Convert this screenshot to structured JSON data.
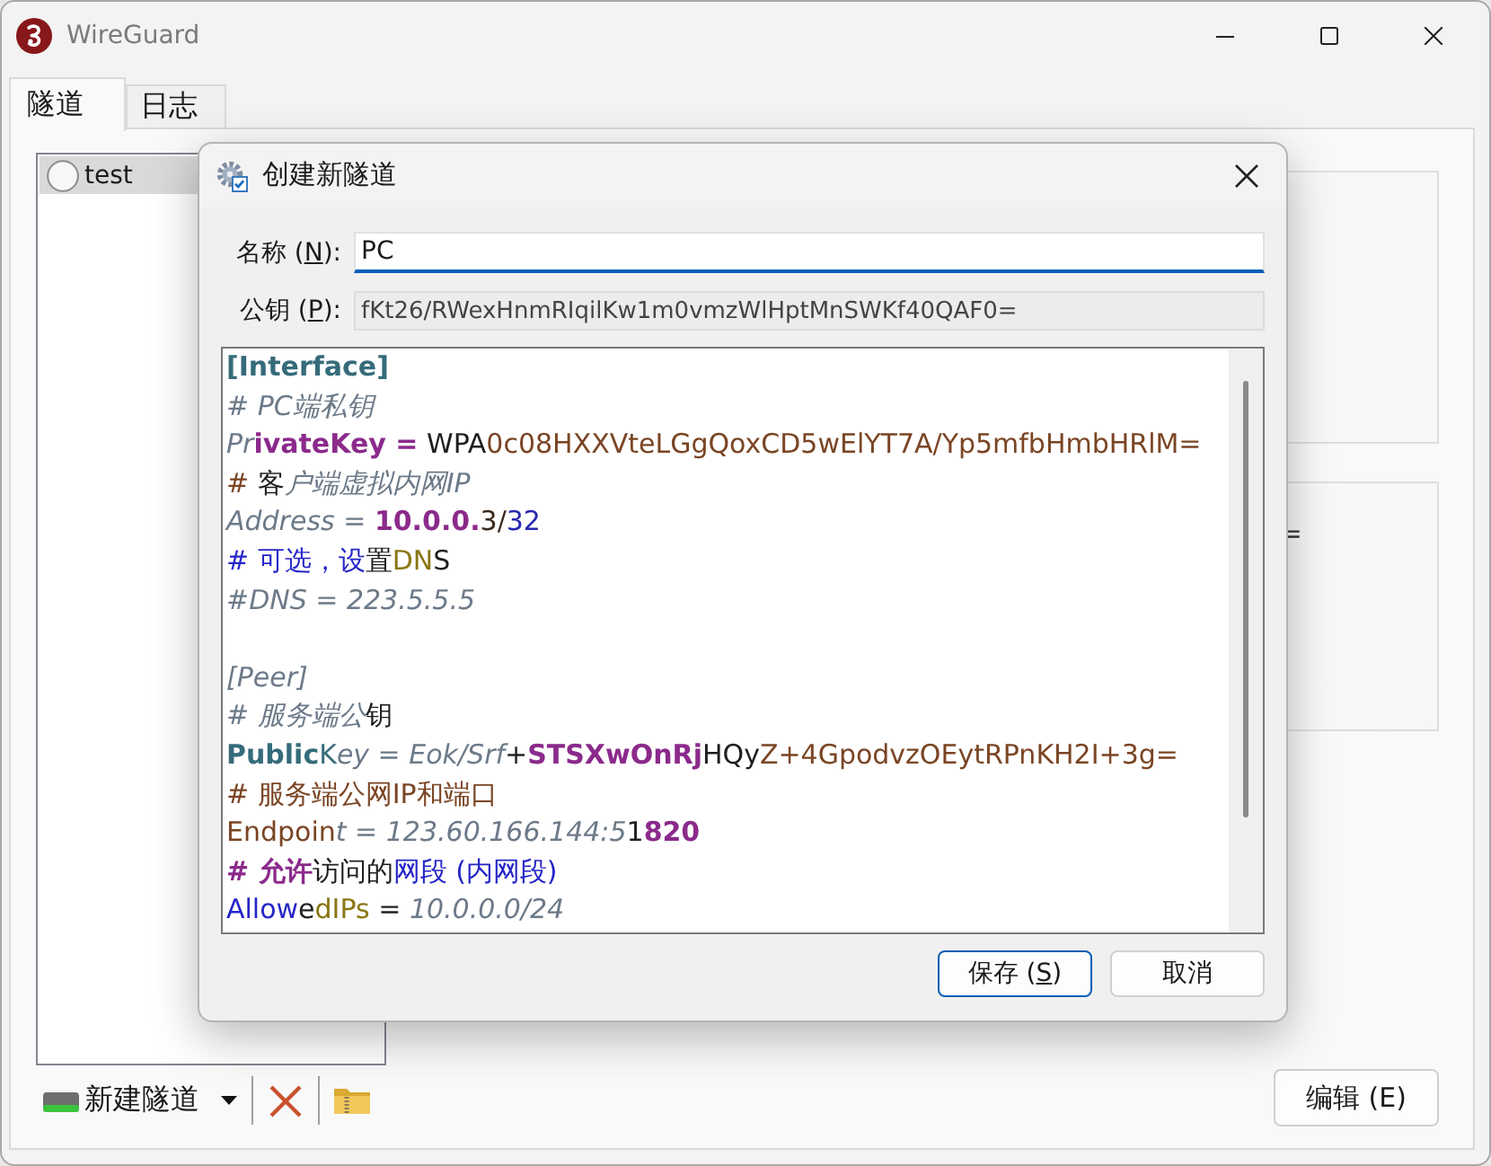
{
  "window": {
    "title": "WireGuard"
  },
  "tabs": [
    {
      "label": "隧道",
      "selected": true
    },
    {
      "label": "日志",
      "selected": false
    }
  ],
  "tunnels": [
    {
      "name": "test",
      "selected": true
    }
  ],
  "details": {
    "visible_text": "="
  },
  "toolbar": {
    "new_tunnel": "新建隧道"
  },
  "edit_button": "编辑 (E)",
  "dialog": {
    "title": "创建新隧道",
    "fields": [
      {
        "kind": "input",
        "label": "名称 (",
        "access_key": "N",
        "label_after": "):",
        "value": "PC",
        "focused": true
      },
      {
        "kind": "readonly",
        "label": "公钥 (",
        "access_key": "P",
        "label_after": "):",
        "value": "fKt26/RWexHnmRIqilKw1m0vmzWlHptMnSWKf40QAF0=",
        "focused": false
      }
    ],
    "editor": {
      "lines": [
        {
          "kind": "code",
          "segments": [
            {
              "text": "[Interface]",
              "color": "#356b7a",
              "bold": true,
              "italic": false
            }
          ]
        },
        {
          "kind": "code",
          "segments": [
            {
              "text": "# PC端私钥",
              "color": "#6c7a89",
              "bold": false,
              "italic": true
            }
          ]
        },
        {
          "kind": "code",
          "segments": [
            {
              "text": "Pr",
              "color": "#6c7a89",
              "bold": false,
              "italic": true
            },
            {
              "text": "ivateKey =",
              "color": "#8b2a8b",
              "bold": true,
              "italic": false
            },
            {
              "text": " WPA",
              "color": "#1e1e1e",
              "bold": false,
              "italic": false
            },
            {
              "text": "0c08HXXVteLGgQoxCD5wElYT7A/Yp5mfbHmbHRlM=",
              "color": "#7a4524",
              "bold": false,
              "italic": false
            }
          ]
        },
        {
          "kind": "code",
          "segments": [
            {
              "text": "# ",
              "color": "#7a4524",
              "bold": false,
              "italic": false
            },
            {
              "text": "客",
              "color": "#1e1e1e",
              "bold": false,
              "italic": false
            },
            {
              "text": "户端虚拟内网IP",
              "color": "#6c7a89",
              "bold": false,
              "italic": true
            }
          ]
        },
        {
          "kind": "code",
          "segments": [
            {
              "text": "Address = ",
              "color": "#6c7a89",
              "bold": false,
              "italic": true
            },
            {
              "text": "10.0.0.",
              "color": "#8b2a8b",
              "bold": true,
              "italic": false
            },
            {
              "text": "3/",
              "color": "#3b2a1e",
              "bold": false,
              "italic": false
            },
            {
              "text": "32",
              "color": "#2727b0",
              "bold": false,
              "italic": false
            }
          ]
        },
        {
          "kind": "code",
          "segments": [
            {
              "text": "# 可选，设",
              "color": "#2525c8",
              "bold": false,
              "italic": false
            },
            {
              "text": "置",
              "color": "#1e1e1e",
              "bold": false,
              "italic": false
            },
            {
              "text": "DN",
              "color": "#8a7714",
              "bold": false,
              "italic": false
            },
            {
              "text": "S",
              "color": "#1e1e1e",
              "bold": false,
              "italic": false
            }
          ]
        },
        {
          "kind": "code",
          "segments": [
            {
              "text": "#DNS = 223.5.5.5",
              "color": "#6c7a89",
              "bold": false,
              "italic": true
            }
          ]
        },
        {
          "kind": "blank"
        },
        {
          "kind": "code",
          "segments": [
            {
              "text": "[Peer]",
              "color": "#6c7a89",
              "bold": false,
              "italic": true
            }
          ]
        },
        {
          "kind": "code",
          "segments": [
            {
              "text": "# 服务端公",
              "color": "#6c7a89",
              "bold": false,
              "italic": true
            },
            {
              "text": "钥",
              "color": "#1e1e1e",
              "bold": false,
              "italic": false
            }
          ]
        },
        {
          "kind": "code",
          "segments": [
            {
              "text": "Public",
              "color": "#356b7a",
              "bold": true,
              "italic": false
            },
            {
              "text": "K",
              "color": "#356b7a",
              "bold": false,
              "italic": false
            },
            {
              "text": "ey = Eok/Srf",
              "color": "#6c7a89",
              "bold": false,
              "italic": true
            },
            {
              "text": "+",
              "color": "#1e1e1e",
              "bold": false,
              "italic": false
            },
            {
              "text": "STSXwOnRj",
              "color": "#8b2a8b",
              "bold": true,
              "italic": false
            },
            {
              "text": "HQy",
              "color": "#1e1e1e",
              "bold": false,
              "italic": false
            },
            {
              "text": "Z+4GpodvzOEytRPnKH2I+3g=",
              "color": "#7a4524",
              "bold": false,
              "italic": false
            }
          ]
        },
        {
          "kind": "code",
          "segments": [
            {
              "text": "# 服务端公网IP和端口",
              "color": "#7a4524",
              "bold": false,
              "italic": false
            }
          ]
        },
        {
          "kind": "code",
          "segments": [
            {
              "text": "Endpoin",
              "color": "#7a4524",
              "bold": false,
              "italic": false
            },
            {
              "text": "t = 123.60.166.144:5",
              "color": "#6c7a89",
              "bold": false,
              "italic": true
            },
            {
              "text": "1",
              "color": "#1e1e1e",
              "bold": false,
              "italic": false
            },
            {
              "text": "820",
              "color": "#8b2a8b",
              "bold": true,
              "italic": false
            }
          ]
        },
        {
          "kind": "code",
          "segments": [
            {
              "text": "# 允许",
              "color": "#8b2a8b",
              "bold": true,
              "italic": false
            },
            {
              "text": "访问的",
              "color": "#1e1e1e",
              "bold": false,
              "italic": false
            },
            {
              "text": "网段 (内网段)",
              "color": "#2525c8",
              "bold": false,
              "italic": false
            }
          ]
        },
        {
          "kind": "code",
          "segments": [
            {
              "text": "Allow",
              "color": "#2525c8",
              "bold": false,
              "italic": false
            },
            {
              "text": "e",
              "color": "#1e1e1e",
              "bold": false,
              "italic": false
            },
            {
              "text": "dIPs",
              "color": "#8a7714",
              "bold": false,
              "italic": false
            },
            {
              "text": " = ",
              "color": "#1e1e1e",
              "bold": false,
              "italic": false
            },
            {
              "text": "10.0.0.0/24",
              "color": "#6c7a89",
              "bold": false,
              "italic": true
            }
          ]
        }
      ]
    },
    "buttons": [
      {
        "label": "保存 (",
        "access_key": "S",
        "label_after": ")",
        "default": true
      },
      {
        "label": "取消",
        "default": false
      }
    ]
  }
}
